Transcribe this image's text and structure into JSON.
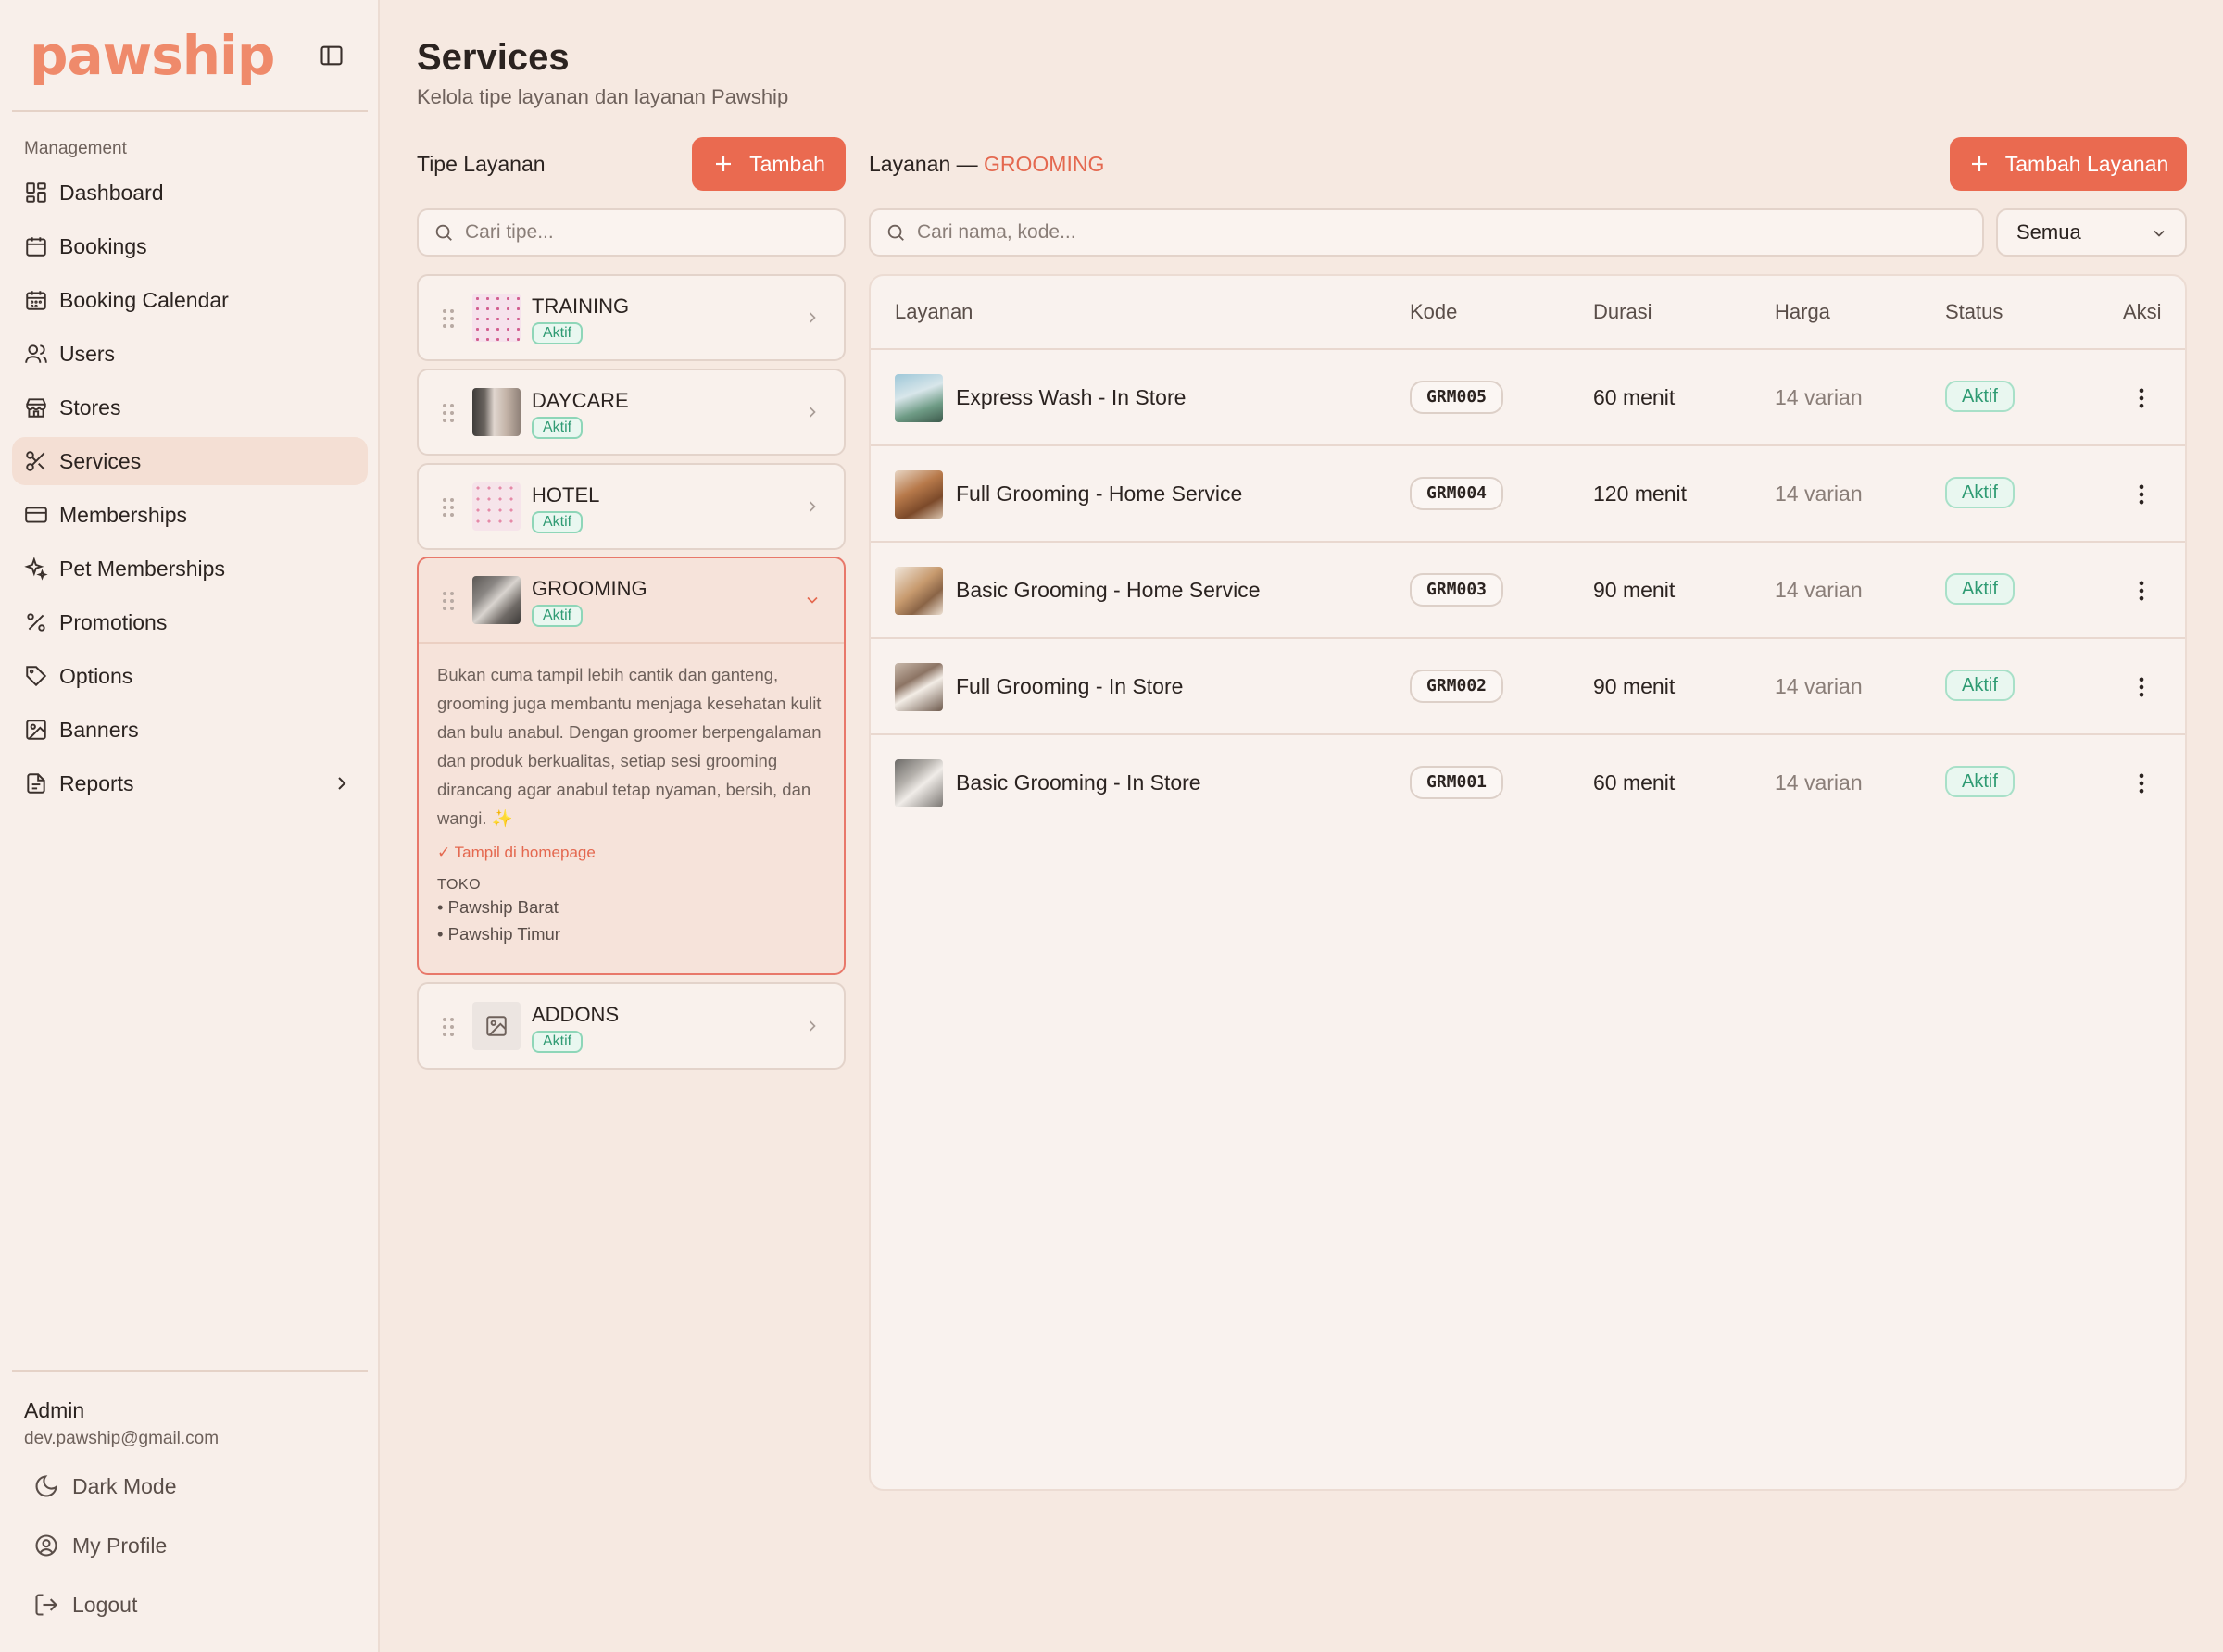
{
  "sidebar": {
    "logo": "pawship",
    "section_label": "Management",
    "items": [
      {
        "label": "Dashboard",
        "icon": "dashboard-icon"
      },
      {
        "label": "Bookings",
        "icon": "calendar-icon"
      },
      {
        "label": "Booking Calendar",
        "icon": "calendar-icon"
      },
      {
        "label": "Users",
        "icon": "users-icon"
      },
      {
        "label": "Stores",
        "icon": "store-icon"
      },
      {
        "label": "Services",
        "icon": "scissors-icon"
      },
      {
        "label": "Memberships",
        "icon": "credit-card-icon"
      },
      {
        "label": "Pet Memberships",
        "icon": "paw-icon"
      },
      {
        "label": "Promotions",
        "icon": "percent-icon"
      },
      {
        "label": "Options",
        "icon": "tag-icon"
      },
      {
        "label": "Banners",
        "icon": "image-icon"
      },
      {
        "label": "Reports",
        "icon": "file-icon"
      }
    ],
    "user": {
      "name": "Admin",
      "email": "dev.pawship@gmail.com"
    },
    "bottom": {
      "dark_mode": "Dark Mode",
      "profile": "My Profile",
      "logout": "Logout"
    }
  },
  "header": {
    "title": "Services",
    "subtitle": "Kelola tipe layanan dan layanan Pawship"
  },
  "types": {
    "title": "Tipe Layanan",
    "add_label": "Tambah",
    "search_placeholder": "Cari tipe...",
    "items": [
      {
        "name": "TRAINING",
        "status": "Aktif"
      },
      {
        "name": "DAYCARE",
        "status": "Aktif"
      },
      {
        "name": "HOTEL",
        "status": "Aktif"
      },
      {
        "name": "GROOMING",
        "status": "Aktif",
        "description": "Bukan cuma tampil lebih cantik dan ganteng, grooming juga membantu menjaga kesehatan kulit dan bulu anabul. Dengan groomer berpengalaman dan produk berkualitas, setiap sesi grooming dirancang agar anabul tetap nyaman, bersih, dan wangi. ✨",
        "homepage": "✓ Tampil di homepage",
        "stores_label": "TOKO",
        "stores": [
          "• Pawship Barat",
          "• Pawship Timur"
        ]
      },
      {
        "name": "ADDONS",
        "status": "Aktif"
      }
    ]
  },
  "services": {
    "title_prefix": "Layanan —",
    "title_type": "GROOMING",
    "add_label": "Tambah Layanan",
    "search_placeholder": "Cari nama, kode...",
    "filter_value": "Semua",
    "columns": {
      "name": "Layanan",
      "code": "Kode",
      "duration": "Durasi",
      "price": "Harga",
      "status": "Status",
      "action": "Aksi"
    },
    "rows": [
      {
        "name": "Express Wash - In Store",
        "code": "GRM005",
        "duration": "60 menit",
        "price": "14 varian",
        "status": "Aktif"
      },
      {
        "name": "Full Grooming - Home Service",
        "code": "GRM004",
        "duration": "120 menit",
        "price": "14 varian",
        "status": "Aktif"
      },
      {
        "name": "Basic Grooming - Home Service",
        "code": "GRM003",
        "duration": "90 menit",
        "price": "14 varian",
        "status": "Aktif"
      },
      {
        "name": "Full Grooming - In Store",
        "code": "GRM002",
        "duration": "90 menit",
        "price": "14 varian",
        "status": "Aktif"
      },
      {
        "name": "Basic Grooming - In Store",
        "code": "GRM001",
        "duration": "60 menit",
        "price": "14 varian",
        "status": "Aktif"
      }
    ]
  },
  "colors": {
    "accent": "#ea6a50",
    "success": "#2f9b73",
    "background": "#f6e9e1"
  }
}
